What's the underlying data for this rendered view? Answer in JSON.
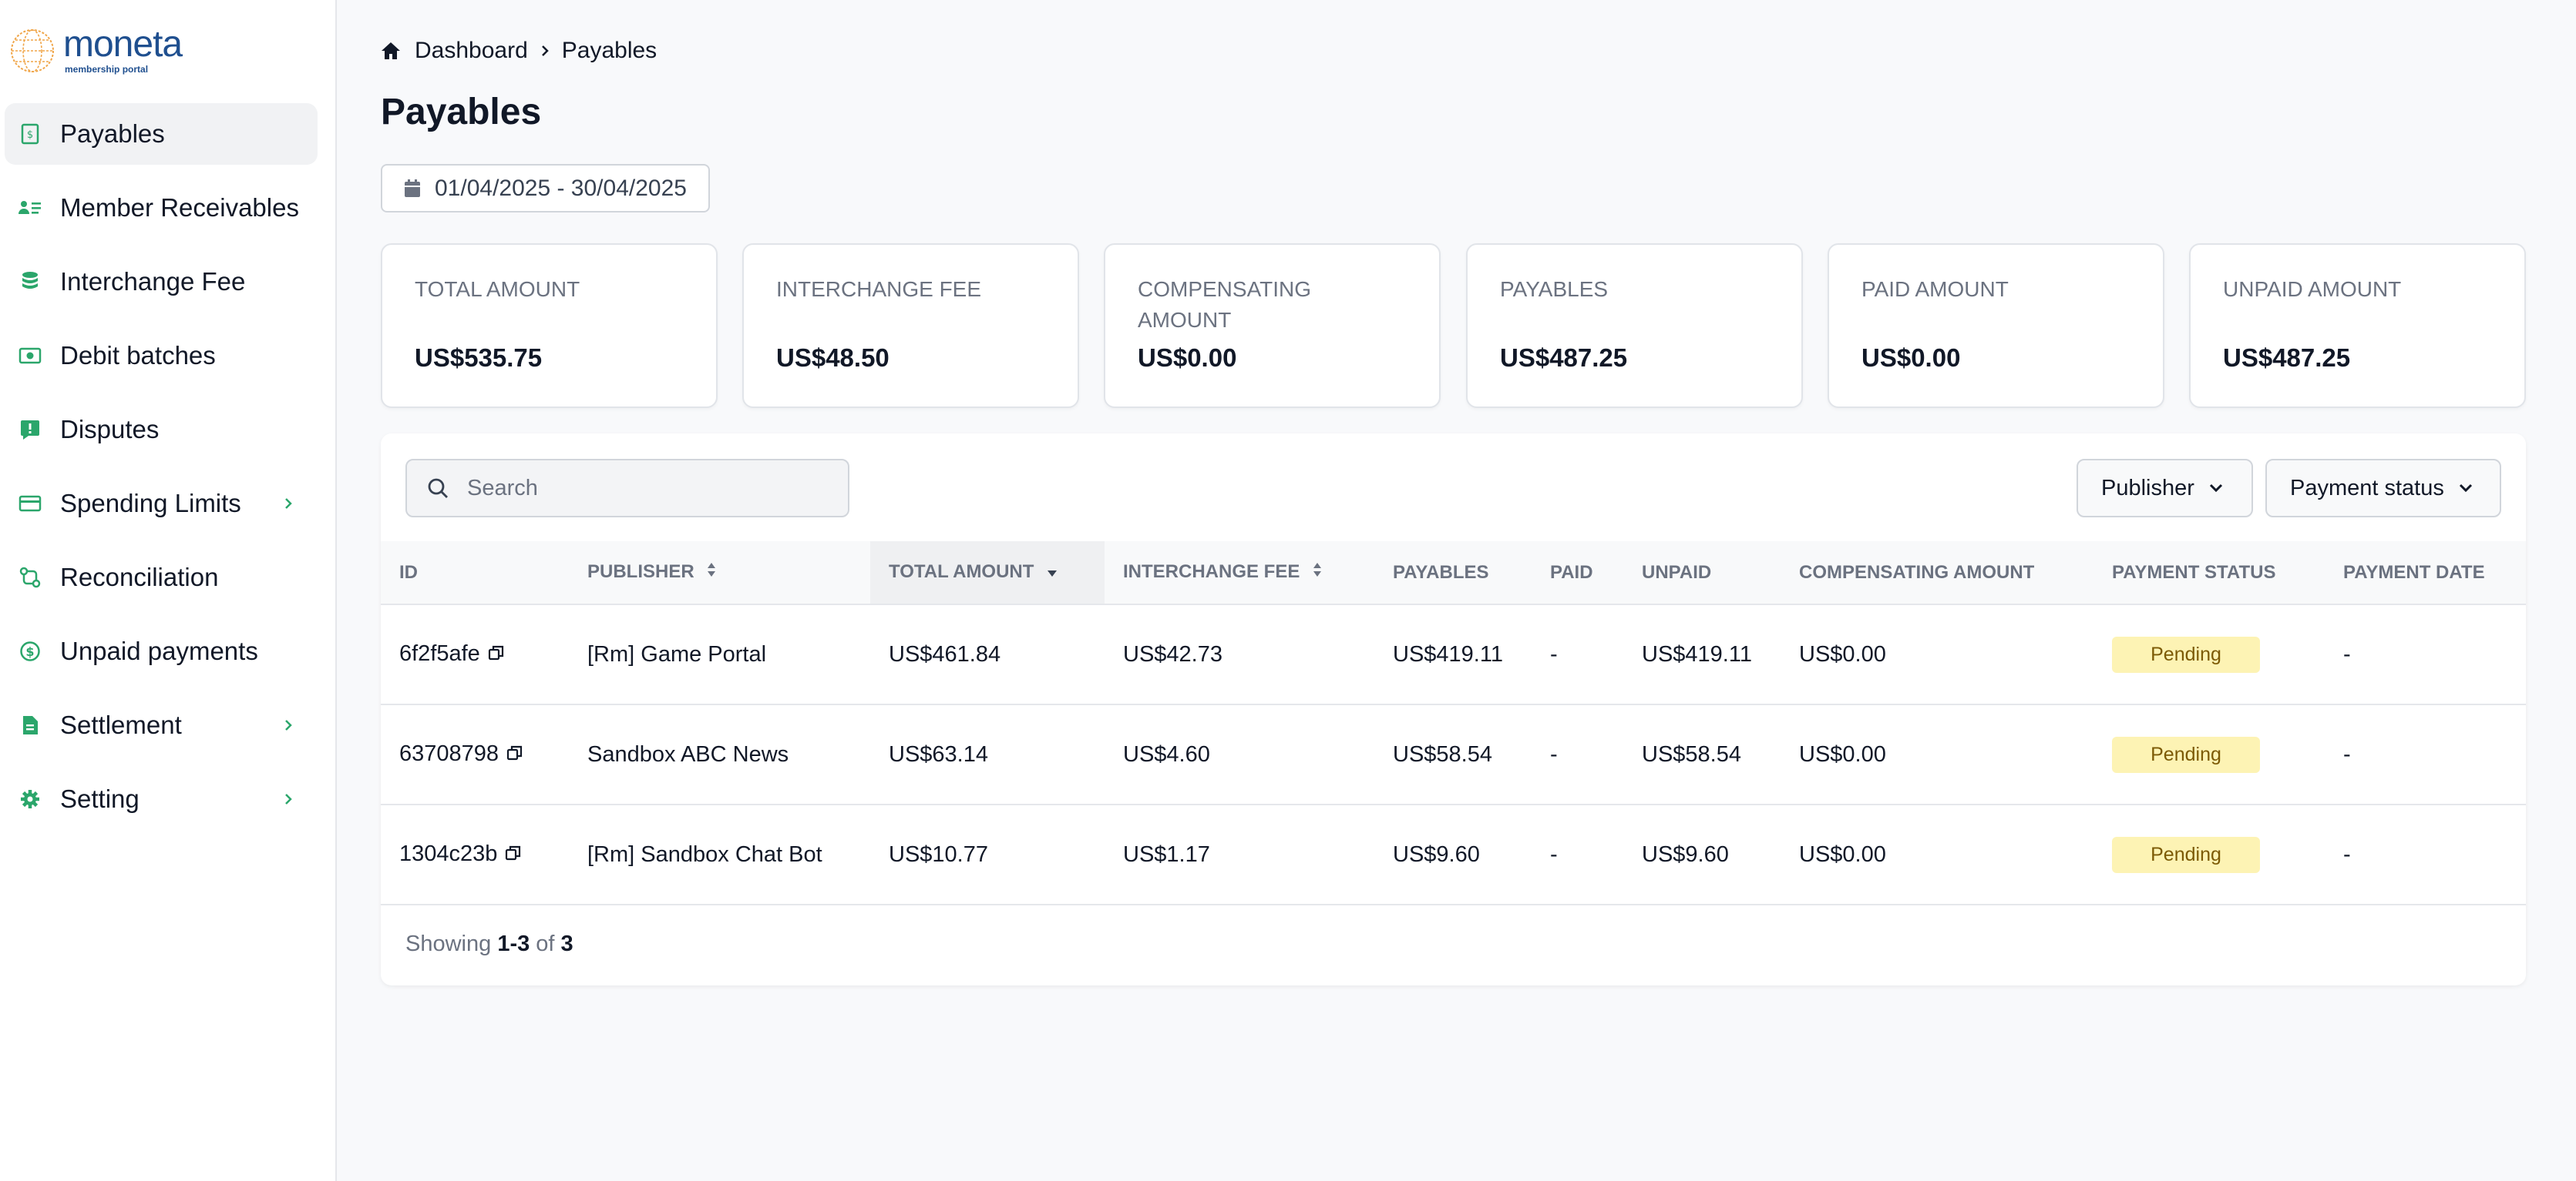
{
  "brand": {
    "name": "moneta",
    "tagline": "membership portal",
    "color": "#1f4f8f",
    "accent": "#f0a64a"
  },
  "sidebar": {
    "items": [
      {
        "label": "Payables",
        "icon": "receipt-icon",
        "active": true,
        "has_submenu": false
      },
      {
        "label": "Member Receivables",
        "icon": "users-list-icon",
        "active": false,
        "has_submenu": false
      },
      {
        "label": "Interchange Fee",
        "icon": "coins-stack-icon",
        "active": false,
        "has_submenu": false
      },
      {
        "label": "Debit batches",
        "icon": "banknote-icon",
        "active": false,
        "has_submenu": false
      },
      {
        "label": "Disputes",
        "icon": "alert-message-icon",
        "active": false,
        "has_submenu": false
      },
      {
        "label": "Spending Limits",
        "icon": "credit-card-icon",
        "active": false,
        "has_submenu": true
      },
      {
        "label": "Reconciliation",
        "icon": "reconcile-icon",
        "active": false,
        "has_submenu": false
      },
      {
        "label": "Unpaid payments",
        "icon": "dollar-circle-icon",
        "active": false,
        "has_submenu": false
      },
      {
        "label": "Settlement",
        "icon": "document-icon",
        "active": false,
        "has_submenu": true
      },
      {
        "label": "Setting",
        "icon": "gear-icon",
        "active": false,
        "has_submenu": true
      }
    ],
    "icon_color": "#2ba66b"
  },
  "breadcrumb": {
    "home": "Dashboard",
    "current": "Payables"
  },
  "page": {
    "title": "Payables"
  },
  "date_range": "01/04/2025 - 30/04/2025",
  "summary_cards": [
    {
      "label": "TOTAL AMOUNT",
      "value": "US$535.75"
    },
    {
      "label": "INTERCHANGE FEE",
      "value": "US$48.50"
    },
    {
      "label": "COMPENSATING AMOUNT",
      "value": "US$0.00"
    },
    {
      "label": "PAYABLES",
      "value": "US$487.25"
    },
    {
      "label": "PAID AMOUNT",
      "value": "US$0.00"
    },
    {
      "label": "UNPAID AMOUNT",
      "value": "US$487.25"
    }
  ],
  "search": {
    "placeholder": "Search"
  },
  "filters": {
    "publisher": "Publisher",
    "payment_status": "Payment status"
  },
  "table": {
    "columns": [
      {
        "label": "ID",
        "sortable": false
      },
      {
        "label": "PUBLISHER",
        "sortable": true
      },
      {
        "label": "TOTAL AMOUNT",
        "sortable": true,
        "sorted": "desc"
      },
      {
        "label": "INTERCHANGE FEE",
        "sortable": true
      },
      {
        "label": "PAYABLES",
        "sortable": false
      },
      {
        "label": "PAID",
        "sortable": false
      },
      {
        "label": "UNPAID",
        "sortable": false
      },
      {
        "label": "COMPENSATING AMOUNT",
        "sortable": false
      },
      {
        "label": "PAYMENT STATUS",
        "sortable": false
      },
      {
        "label": "PAYMENT DATE",
        "sortable": false
      }
    ],
    "rows": [
      {
        "id": "6f2f5afe",
        "publisher": "[Rm] Game Portal",
        "total": "US$461.84",
        "fee": "US$42.73",
        "payables": "US$419.11",
        "paid": "-",
        "unpaid": "US$419.11",
        "compensating": "US$0.00",
        "status": "Pending",
        "date": "-"
      },
      {
        "id": "63708798",
        "publisher": "Sandbox ABC News",
        "total": "US$63.14",
        "fee": "US$4.60",
        "payables": "US$58.54",
        "paid": "-",
        "unpaid": "US$58.54",
        "compensating": "US$0.00",
        "status": "Pending",
        "date": "-"
      },
      {
        "id": "1304c23b",
        "publisher": "[Rm] Sandbox Chat Bot",
        "total": "US$10.77",
        "fee": "US$1.17",
        "payables": "US$9.60",
        "paid": "-",
        "unpaid": "US$9.60",
        "compensating": "US$0.00",
        "status": "Pending",
        "date": "-"
      }
    ]
  },
  "pagination": {
    "prefix": "Showing",
    "range": "1-3",
    "of": "of",
    "total": "3"
  }
}
